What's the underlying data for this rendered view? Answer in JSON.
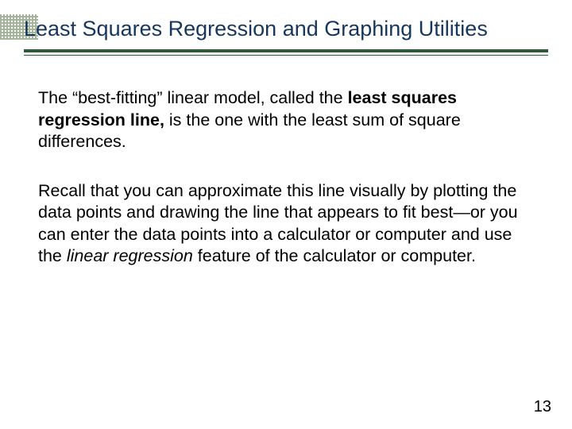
{
  "slide": {
    "title": "Least Squares Regression and Graphing Utilities",
    "para1": {
      "pre": "The “best-fitting” linear model, called the ",
      "strong": "least squares regression line,",
      "post": " is the one with the least sum of square differences."
    },
    "para2": {
      "pre": "Recall that you can approximate this line visually by plotting the data points and drawing the line that appears to fit best—or you can enter the data points into a calculator or computer and use the ",
      "italic": "linear regression",
      "post": " feature of the calculator or computer."
    },
    "page_number": "13"
  }
}
